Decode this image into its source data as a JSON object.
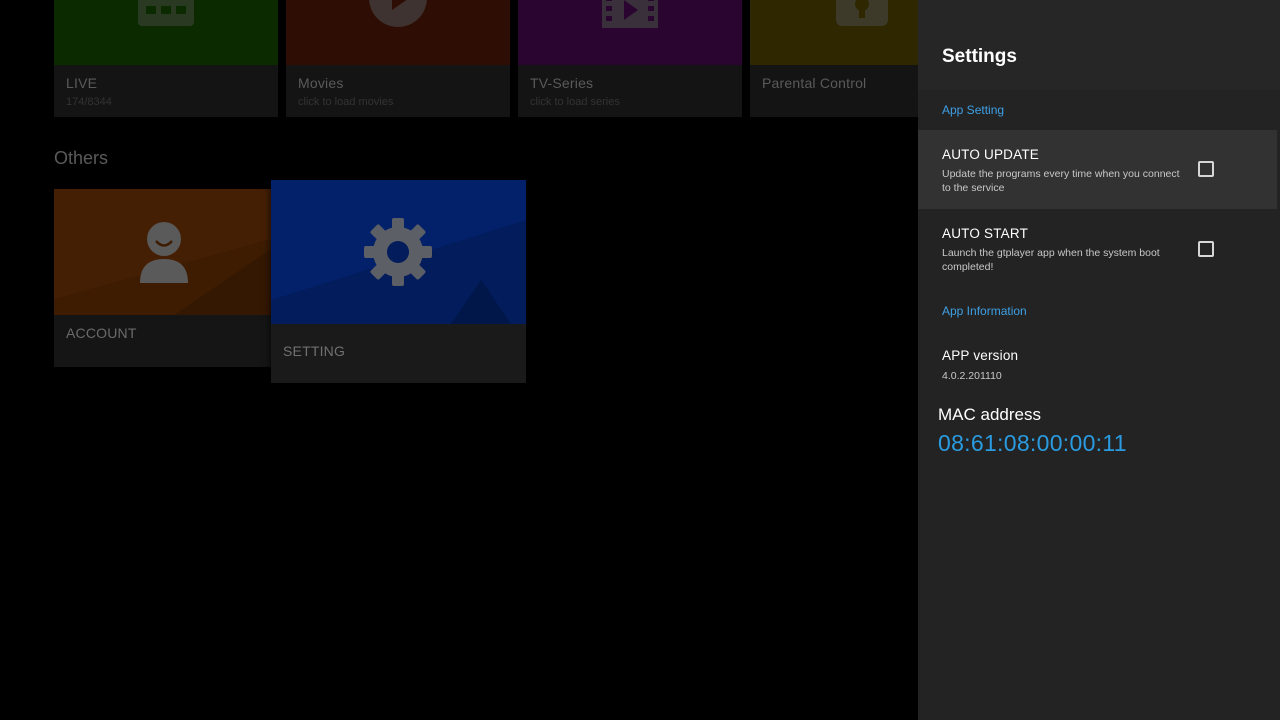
{
  "home": {
    "tiles": {
      "live": {
        "title": "LIVE",
        "subtitle": "174/8344",
        "color": "#0c2a00",
        "icon": "grid-tv-icon"
      },
      "movies": {
        "title": "Movies",
        "subtitle": "click to load movies",
        "color": "#2e0e04",
        "icon": "play-icon"
      },
      "series": {
        "title": "TV-Series",
        "subtitle": "click to load series",
        "color": "#2a0530",
        "icon": "film-icon"
      },
      "parental": {
        "title": "Parental Control",
        "subtitle": "",
        "color": "#2e2700",
        "icon": "lock-icon"
      }
    },
    "others_title": "Others",
    "account": {
      "title": "ACCOUNT",
      "color": "#3d1c02",
      "icon": "person-icon"
    },
    "setting": {
      "title": "SETTING",
      "color": "#021c5c",
      "icon": "gear-icon"
    }
  },
  "settings": {
    "title": "Settings",
    "section_app_setting": "App Setting",
    "auto_update": {
      "title": "AUTO UPDATE",
      "summary": "Update the programs every time when you connect to the service",
      "checked": false
    },
    "auto_start": {
      "title": "AUTO START",
      "summary": "Launch the gtplayer app when the system boot completed!",
      "checked": false
    },
    "section_app_info": "App Information",
    "app_version": {
      "title": "APP version",
      "value": "4.0.2.201110"
    },
    "mac": {
      "label": "MAC address",
      "value": "08:61:08:00:00:11"
    },
    "accent_color": "#3ea0e6"
  }
}
